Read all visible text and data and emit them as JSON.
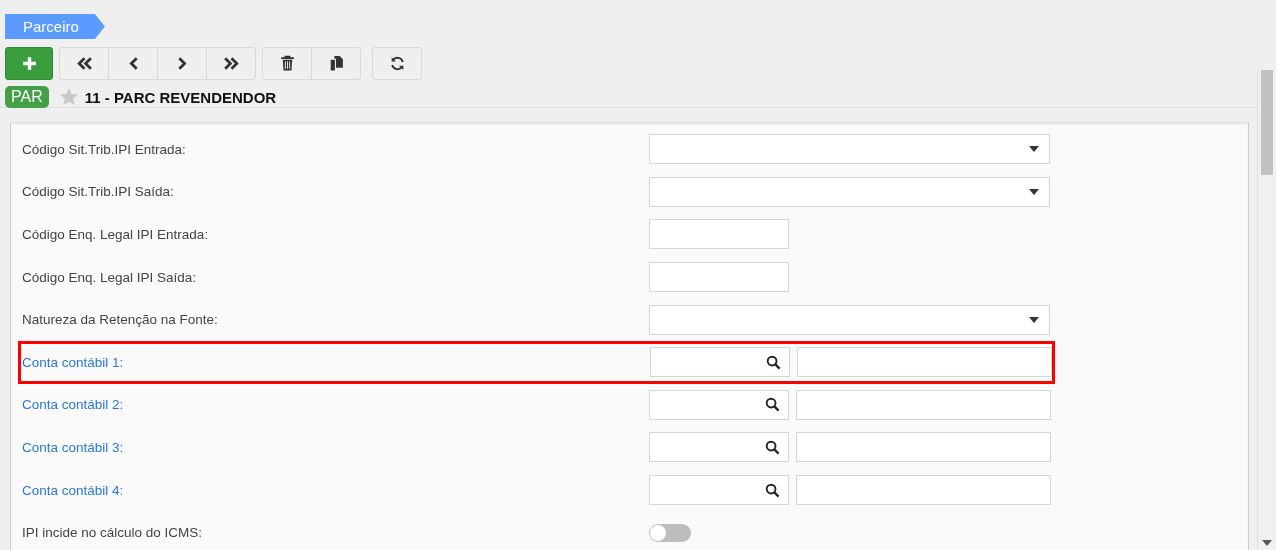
{
  "breadcrumb": {
    "label": "Parceiro"
  },
  "toolbar": [
    [
      {
        "kind": "add"
      }
    ],
    [
      {
        "kind": "first"
      },
      {
        "kind": "prev"
      },
      {
        "kind": "next"
      },
      {
        "kind": "last"
      }
    ],
    [
      {
        "kind": "delete"
      },
      {
        "kind": "copy"
      }
    ],
    [
      {
        "kind": "refresh"
      }
    ]
  ],
  "record": {
    "badge": "PAR",
    "favorite": false,
    "title": "11 - PARC REVENDENDOR"
  },
  "fields": [
    {
      "label": "Código Sit.Trib.IPI Entrada:",
      "kind": "select",
      "highlighted": false
    },
    {
      "label": "Código Sit.Trib.IPI Saída:",
      "kind": "select",
      "highlighted": false
    },
    {
      "label": "Código Enq. Legal IPI Entrada:",
      "kind": "text",
      "highlighted": false
    },
    {
      "label": "Código Enq. Legal IPI Saída:",
      "kind": "text",
      "highlighted": false
    },
    {
      "label": "Natureza da Retenção na Fonte:",
      "kind": "select",
      "highlighted": false
    },
    {
      "label": "Conta contábil 1:",
      "kind": "lookup",
      "highlighted": true
    },
    {
      "label": "Conta contábil 2:",
      "kind": "lookup",
      "highlighted": false
    },
    {
      "label": "Conta contábil 3:",
      "kind": "lookup",
      "highlighted": false
    },
    {
      "label": "Conta contábil 4:",
      "kind": "lookup",
      "highlighted": false
    },
    {
      "label": "IPI incide no cálculo do ICMS:",
      "kind": "toggle",
      "on": false,
      "highlighted": false
    }
  ]
}
